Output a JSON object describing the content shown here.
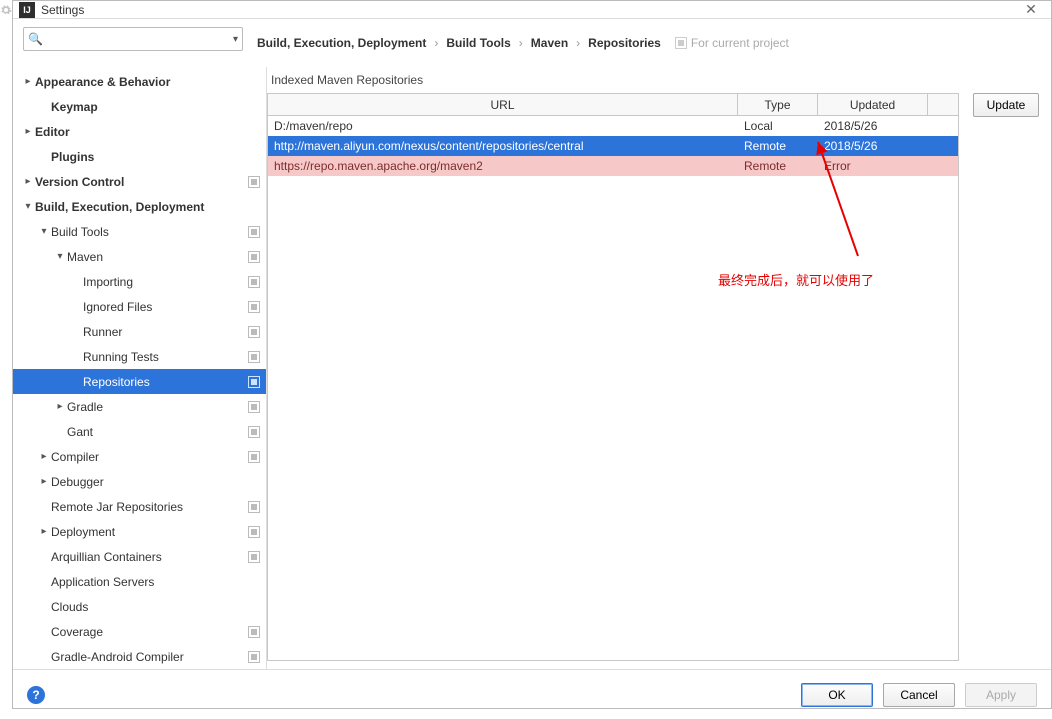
{
  "window": {
    "title": "Settings"
  },
  "search": {
    "placeholder": ""
  },
  "breadcrumb": [
    "Build, Execution, Deployment",
    "Build Tools",
    "Maven",
    "Repositories"
  ],
  "for_project_label": "For current project",
  "sidebar": {
    "items": [
      {
        "label": "Appearance & Behavior",
        "depth": 0,
        "twisty": "right",
        "bold": true
      },
      {
        "label": "Keymap",
        "depth": 1,
        "twisty": "",
        "bold": true
      },
      {
        "label": "Editor",
        "depth": 0,
        "twisty": "right",
        "bold": true
      },
      {
        "label": "Plugins",
        "depth": 1,
        "twisty": "",
        "bold": true
      },
      {
        "label": "Version Control",
        "depth": 0,
        "twisty": "right",
        "bold": true,
        "proj": true
      },
      {
        "label": "Build, Execution, Deployment",
        "depth": 0,
        "twisty": "down",
        "bold": true
      },
      {
        "label": "Build Tools",
        "depth": 1,
        "twisty": "down",
        "bold": false,
        "proj": true
      },
      {
        "label": "Maven",
        "depth": 2,
        "twisty": "down",
        "bold": false,
        "proj": true
      },
      {
        "label": "Importing",
        "depth": 3,
        "twisty": "",
        "bold": false,
        "proj": true
      },
      {
        "label": "Ignored Files",
        "depth": 3,
        "twisty": "",
        "bold": false,
        "proj": true
      },
      {
        "label": "Runner",
        "depth": 3,
        "twisty": "",
        "bold": false,
        "proj": true
      },
      {
        "label": "Running Tests",
        "depth": 3,
        "twisty": "",
        "bold": false,
        "proj": true
      },
      {
        "label": "Repositories",
        "depth": 3,
        "twisty": "",
        "bold": false,
        "proj": true,
        "sel": true
      },
      {
        "label": "Gradle",
        "depth": 2,
        "twisty": "right",
        "bold": false,
        "proj": true
      },
      {
        "label": "Gant",
        "depth": 2,
        "twisty": "",
        "bold": false,
        "proj": true
      },
      {
        "label": "Compiler",
        "depth": 1,
        "twisty": "right",
        "bold": false,
        "proj": true
      },
      {
        "label": "Debugger",
        "depth": 1,
        "twisty": "right",
        "bold": false
      },
      {
        "label": "Remote Jar Repositories",
        "depth": 1,
        "twisty": "",
        "bold": false,
        "proj": true
      },
      {
        "label": "Deployment",
        "depth": 1,
        "twisty": "right",
        "bold": false,
        "proj": true
      },
      {
        "label": "Arquillian Containers",
        "depth": 1,
        "twisty": "",
        "bold": false,
        "proj": true
      },
      {
        "label": "Application Servers",
        "depth": 1,
        "twisty": "",
        "bold": false
      },
      {
        "label": "Clouds",
        "depth": 1,
        "twisty": "",
        "bold": false
      },
      {
        "label": "Coverage",
        "depth": 1,
        "twisty": "",
        "bold": false,
        "proj": true
      },
      {
        "label": "Gradle-Android Compiler",
        "depth": 1,
        "twisty": "",
        "bold": false,
        "proj": true
      }
    ]
  },
  "content": {
    "section_title": "Indexed Maven Repositories",
    "columns": {
      "url": "URL",
      "type": "Type",
      "updated": "Updated"
    },
    "rows": [
      {
        "url": "D:/maven/repo",
        "type": "Local",
        "updated": "2018/5/26",
        "state": "normal"
      },
      {
        "url": "http://maven.aliyun.com/nexus/content/repositories/central",
        "type": "Remote",
        "updated": "2018/5/26",
        "state": "selected"
      },
      {
        "url": "https://repo.maven.apache.org/maven2",
        "type": "Remote",
        "updated": "Error",
        "state": "error"
      }
    ],
    "update_button": "Update"
  },
  "footer": {
    "ok": "OK",
    "cancel": "Cancel",
    "apply": "Apply"
  },
  "annotation": {
    "text": "最终完成后，就可以使用了"
  }
}
